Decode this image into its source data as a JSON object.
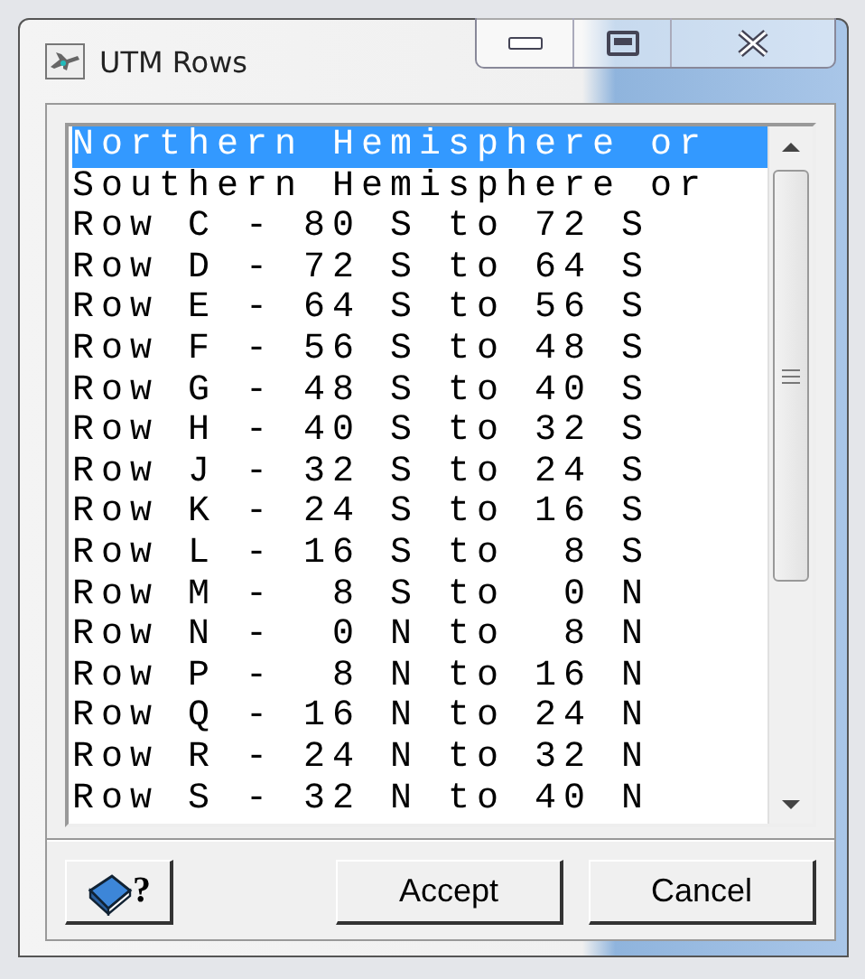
{
  "window": {
    "title": "UTM Rows"
  },
  "list": {
    "items": [
      {
        "label": "Northern Hemisphere or",
        "selected": true
      },
      {
        "label": "Southern Hemisphere or",
        "selected": false
      },
      {
        "label": "Row C - 80 S to 72 S",
        "selected": false
      },
      {
        "label": "Row D - 72 S to 64 S",
        "selected": false
      },
      {
        "label": "Row E - 64 S to 56 S",
        "selected": false
      },
      {
        "label": "Row F - 56 S to 48 S",
        "selected": false
      },
      {
        "label": "Row G - 48 S to 40 S",
        "selected": false
      },
      {
        "label": "Row H - 40 S to 32 S",
        "selected": false
      },
      {
        "label": "Row J - 32 S to 24 S",
        "selected": false
      },
      {
        "label": "Row K - 24 S to 16 S",
        "selected": false
      },
      {
        "label": "Row L - 16 S to  8 S",
        "selected": false
      },
      {
        "label": "Row M -  8 S to  0 N",
        "selected": false
      },
      {
        "label": "Row N -  0 N to  8 N",
        "selected": false
      },
      {
        "label": "Row P -  8 N to 16 N",
        "selected": false
      },
      {
        "label": "Row Q - 16 N to 24 N",
        "selected": false
      },
      {
        "label": "Row R - 24 N to 32 N",
        "selected": false
      },
      {
        "label": "Row S - 32 N to 40 N",
        "selected": false
      }
    ]
  },
  "help_button": {
    "label": "?"
  },
  "buttons": [
    {
      "label": "Accept"
    },
    {
      "label": "Cancel"
    }
  ]
}
